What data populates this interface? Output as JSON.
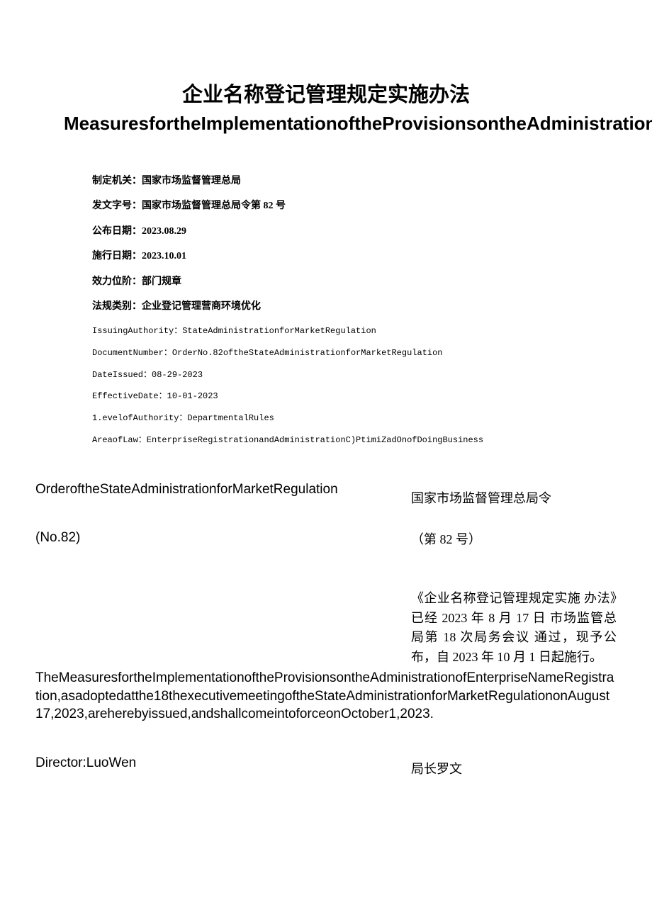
{
  "title": {
    "cn": "企业名称登记管理规定实施办法",
    "en": "MeasuresfortheImplementationoftheProvisionsontheAdministrationofEnterpriseNameRegistration"
  },
  "meta_cn": {
    "issuing_authority": "制定机关：国家市场监督管理总局",
    "document_number": "发文字号：国家市场监督管理总局令第 82 号",
    "date_issued": "公布日期：2023.08.29",
    "effective_date": "施行日期：2023.10.01",
    "level": "效力位阶：部门规章",
    "area": "法规类别：企业登记管理营商环境优化"
  },
  "meta_en": {
    "issuing_authority": "IssuingAuthority：StateAdministrationforMarketRegulation",
    "document_number": "DocumentNumber：OrderNo.82oftheStateAdministrationforMarketRegulation",
    "date_issued": "DateIssued：08-29-2023",
    "effective_date": "EffectiveDate：10-01-2023",
    "level": "1.evelofAuthority：DepartmentalRules",
    "area": "AreaofLaw：EnterpriseRegistrationandAdministrationC)PtimiZadOnofDoingBusiness"
  },
  "order": {
    "en_heading": "OrderoftheStateAdministrationforMarketRegulation",
    "cn_heading": "国家市场监督管理总局令",
    "en_no": "(No.82)",
    "cn_no": "（第 82 号）",
    "cn_para": "《企业名称登记管理规定实施 办法》已经 2023 年 8 月 17 日 市场监管总局第 18 次局务会议 通过，现予公布，自 2023 年 10 月 1 日起施行。",
    "en_para": "TheMeasuresfortheImplementationoftheProvisionsontheAdministrationofEnterpriseNameRegistration,asadoptedatthe18thexecutivemeetingoftheStateAdministrationforMarketRegulationonAugust17,2023,areherebyissued,andshallcomeintoforceonOctober1,2023."
  },
  "signature": {
    "en": "Director:LuoWen",
    "cn": "局长罗文"
  }
}
